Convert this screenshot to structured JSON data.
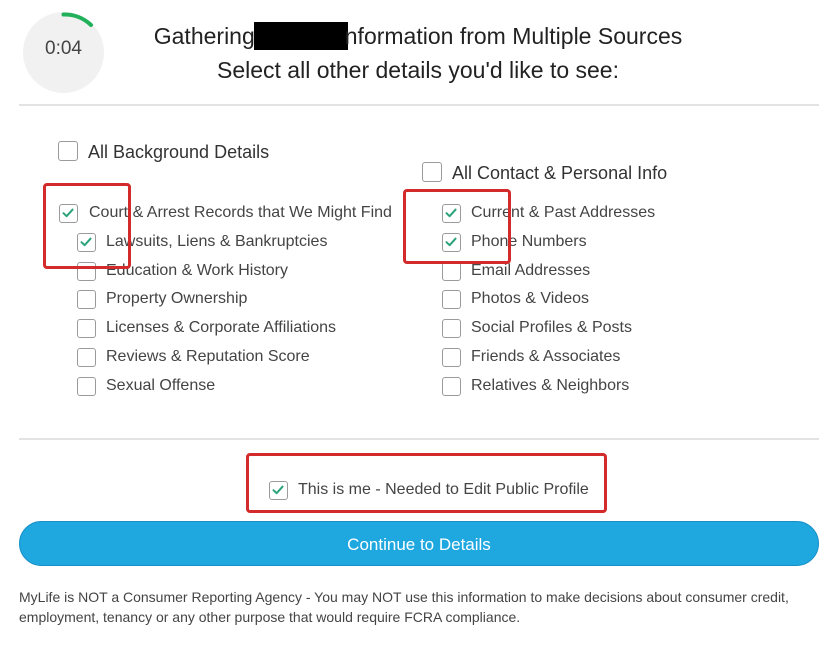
{
  "header": {
    "timer_value": "0:04",
    "title_prefix": "Gathering",
    "title_suffix": "nformation from Multiple Sources",
    "subtitle": "Select all other details you'd like to see:"
  },
  "background_section": {
    "heading": "All Background Details",
    "heading_checked": false,
    "items": [
      {
        "label": "Court & Arrest Records that We Might Find",
        "checked": true
      },
      {
        "label": "Lawsuits, Liens & Bankruptcies",
        "checked": true
      },
      {
        "label": "Education & Work History",
        "checked": false
      },
      {
        "label": "Property Ownership",
        "checked": false
      },
      {
        "label": "Licenses & Corporate Affiliations",
        "checked": false
      },
      {
        "label": "Reviews & Reputation Score",
        "checked": false
      },
      {
        "label": "Sexual Offense",
        "checked": false
      }
    ]
  },
  "contact_section": {
    "heading": "All Contact & Personal Info",
    "heading_checked": false,
    "items": [
      {
        "label": "Current & Past Addresses",
        "checked": true
      },
      {
        "label": "Phone Numbers",
        "checked": true
      },
      {
        "label": "Email Addresses",
        "checked": false
      },
      {
        "label": "Photos & Videos",
        "checked": false
      },
      {
        "label": "Social Profiles & Posts",
        "checked": false
      },
      {
        "label": "Friends & Associates",
        "checked": false
      },
      {
        "label": "Relatives & Neighbors",
        "checked": false
      }
    ]
  },
  "this_is_me": {
    "label": "This is me - Needed to Edit Public Profile",
    "checked": true
  },
  "cta": {
    "label": "Continue to Details"
  },
  "disclaimer": "MyLife is NOT a Consumer Reporting Agency - You may NOT use this information to make decisions about consumer credit, employment, tenancy or any other purpose that would require FCRA compliance.",
  "colors": {
    "accent": "#1fa7e0",
    "check": "#2aa37a",
    "highlight": "#d32b2b",
    "timer_arc": "#21b15b"
  }
}
